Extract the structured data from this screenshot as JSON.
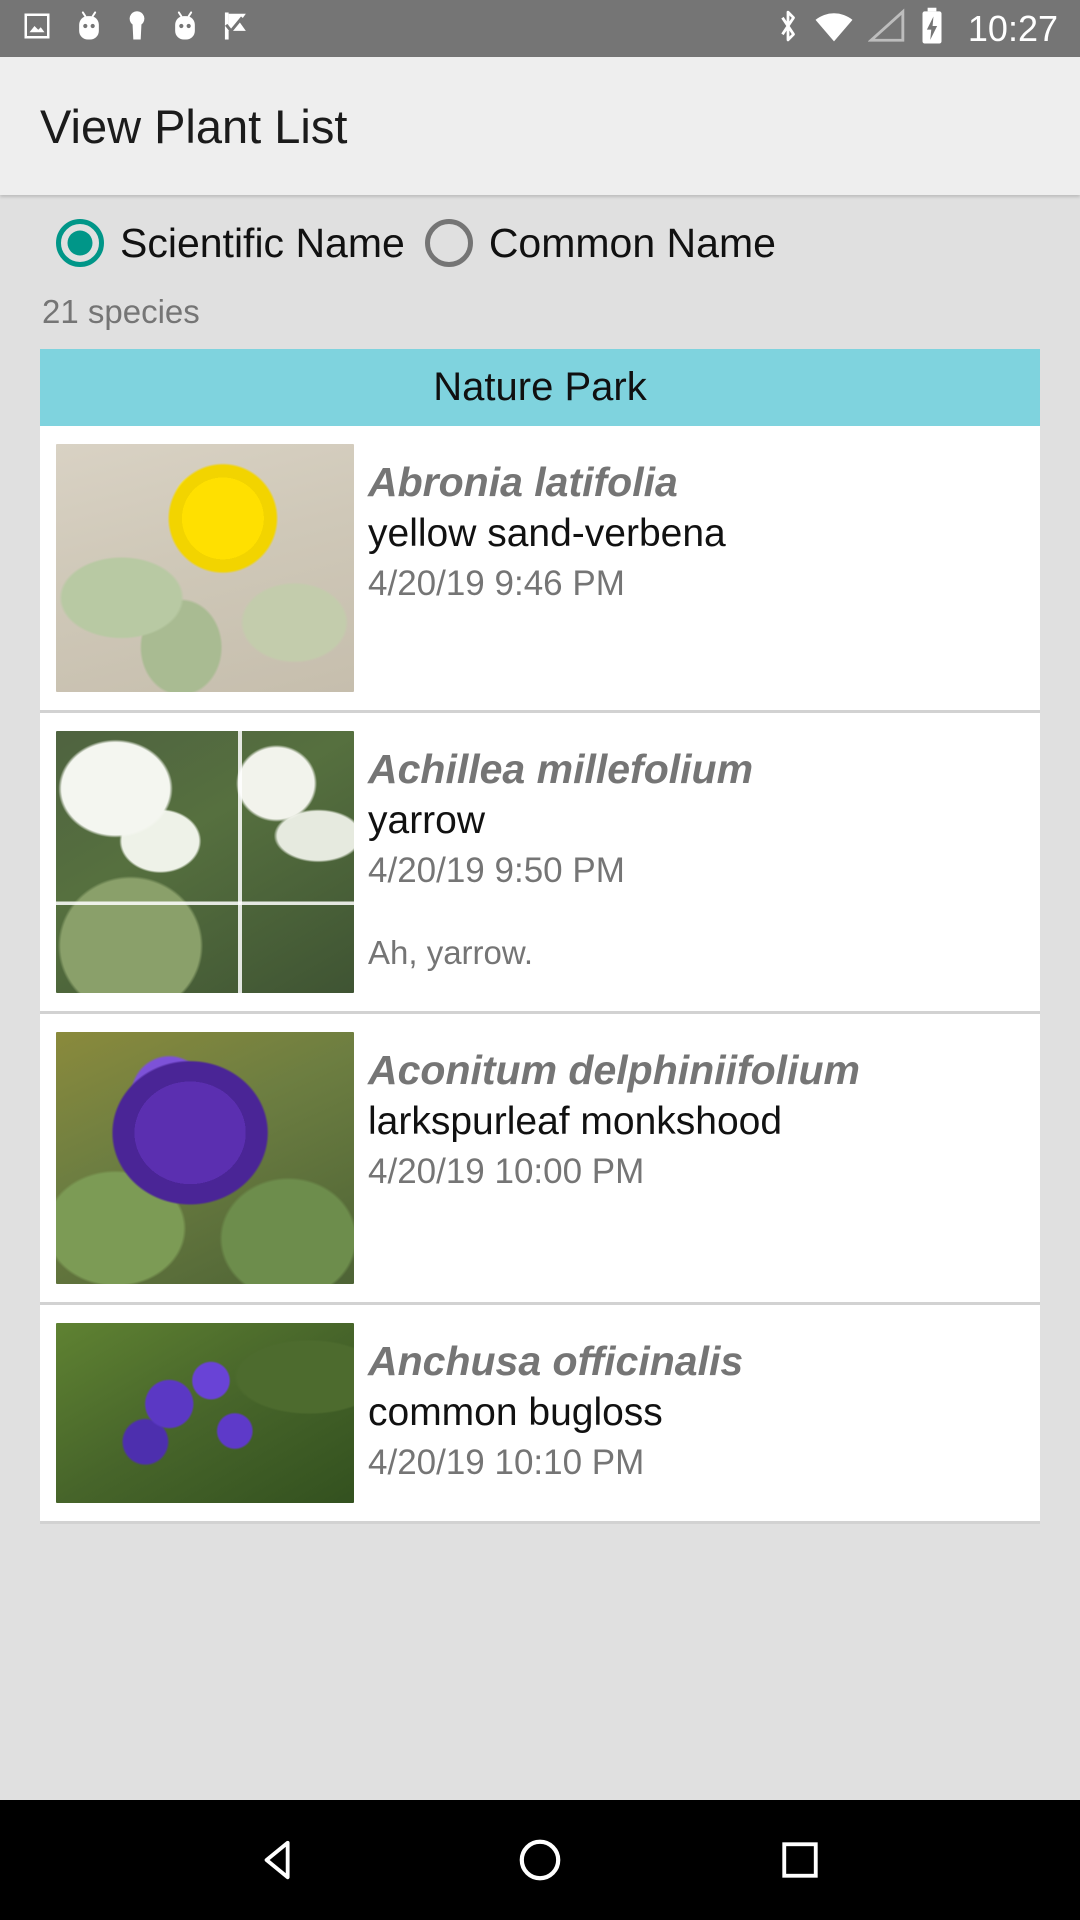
{
  "status_bar": {
    "time": "10:27",
    "left_icons": [
      "image-icon",
      "android-head-icon",
      "key-icon",
      "android-head-icon",
      "checkmark-flag-icon"
    ],
    "right_icons": [
      "bluetooth-icon",
      "wifi-icon",
      "cellular-signal-icon",
      "battery-charging-icon"
    ],
    "background_color": "#757575"
  },
  "appbar": {
    "title": "View Plant List",
    "background_color": "#eeeeee"
  },
  "filter": {
    "options": [
      {
        "label": "Scientific Name",
        "selected": true
      },
      {
        "label": "Common Name",
        "selected": false
      }
    ],
    "selected_color": "#009688",
    "unselected_color": "#757575"
  },
  "summary": {
    "count_text": "21 species"
  },
  "groups": [
    {
      "header": "Nature Park",
      "header_color": "#7fd3de",
      "plants": [
        {
          "scientific_name": "Abronia latifolia",
          "common_name": "yellow sand-verbena",
          "timestamp": "4/20/19 9:46 PM",
          "note": "",
          "thumb_name": "yellow-sand-verbena-photo"
        },
        {
          "scientific_name": "Achillea millefolium",
          "common_name": "yarrow",
          "timestamp": "4/20/19 9:50 PM",
          "note": "Ah, yarrow.",
          "thumb_name": "yarrow-photo"
        },
        {
          "scientific_name": "Aconitum delphiniifolium",
          "common_name": "larkspurleaf monkshood",
          "timestamp": "4/20/19 10:00 PM",
          "note": "",
          "thumb_name": "larkspurleaf-monkshood-photo"
        },
        {
          "scientific_name": "Anchusa officinalis",
          "common_name": "common bugloss",
          "timestamp": "4/20/19 10:10 PM",
          "note": "",
          "thumb_name": "common-bugloss-photo"
        }
      ]
    }
  ],
  "navbar": {
    "buttons": [
      "back-triangle-icon",
      "home-circle-icon",
      "recents-square-icon"
    ],
    "background_color": "#000000"
  }
}
